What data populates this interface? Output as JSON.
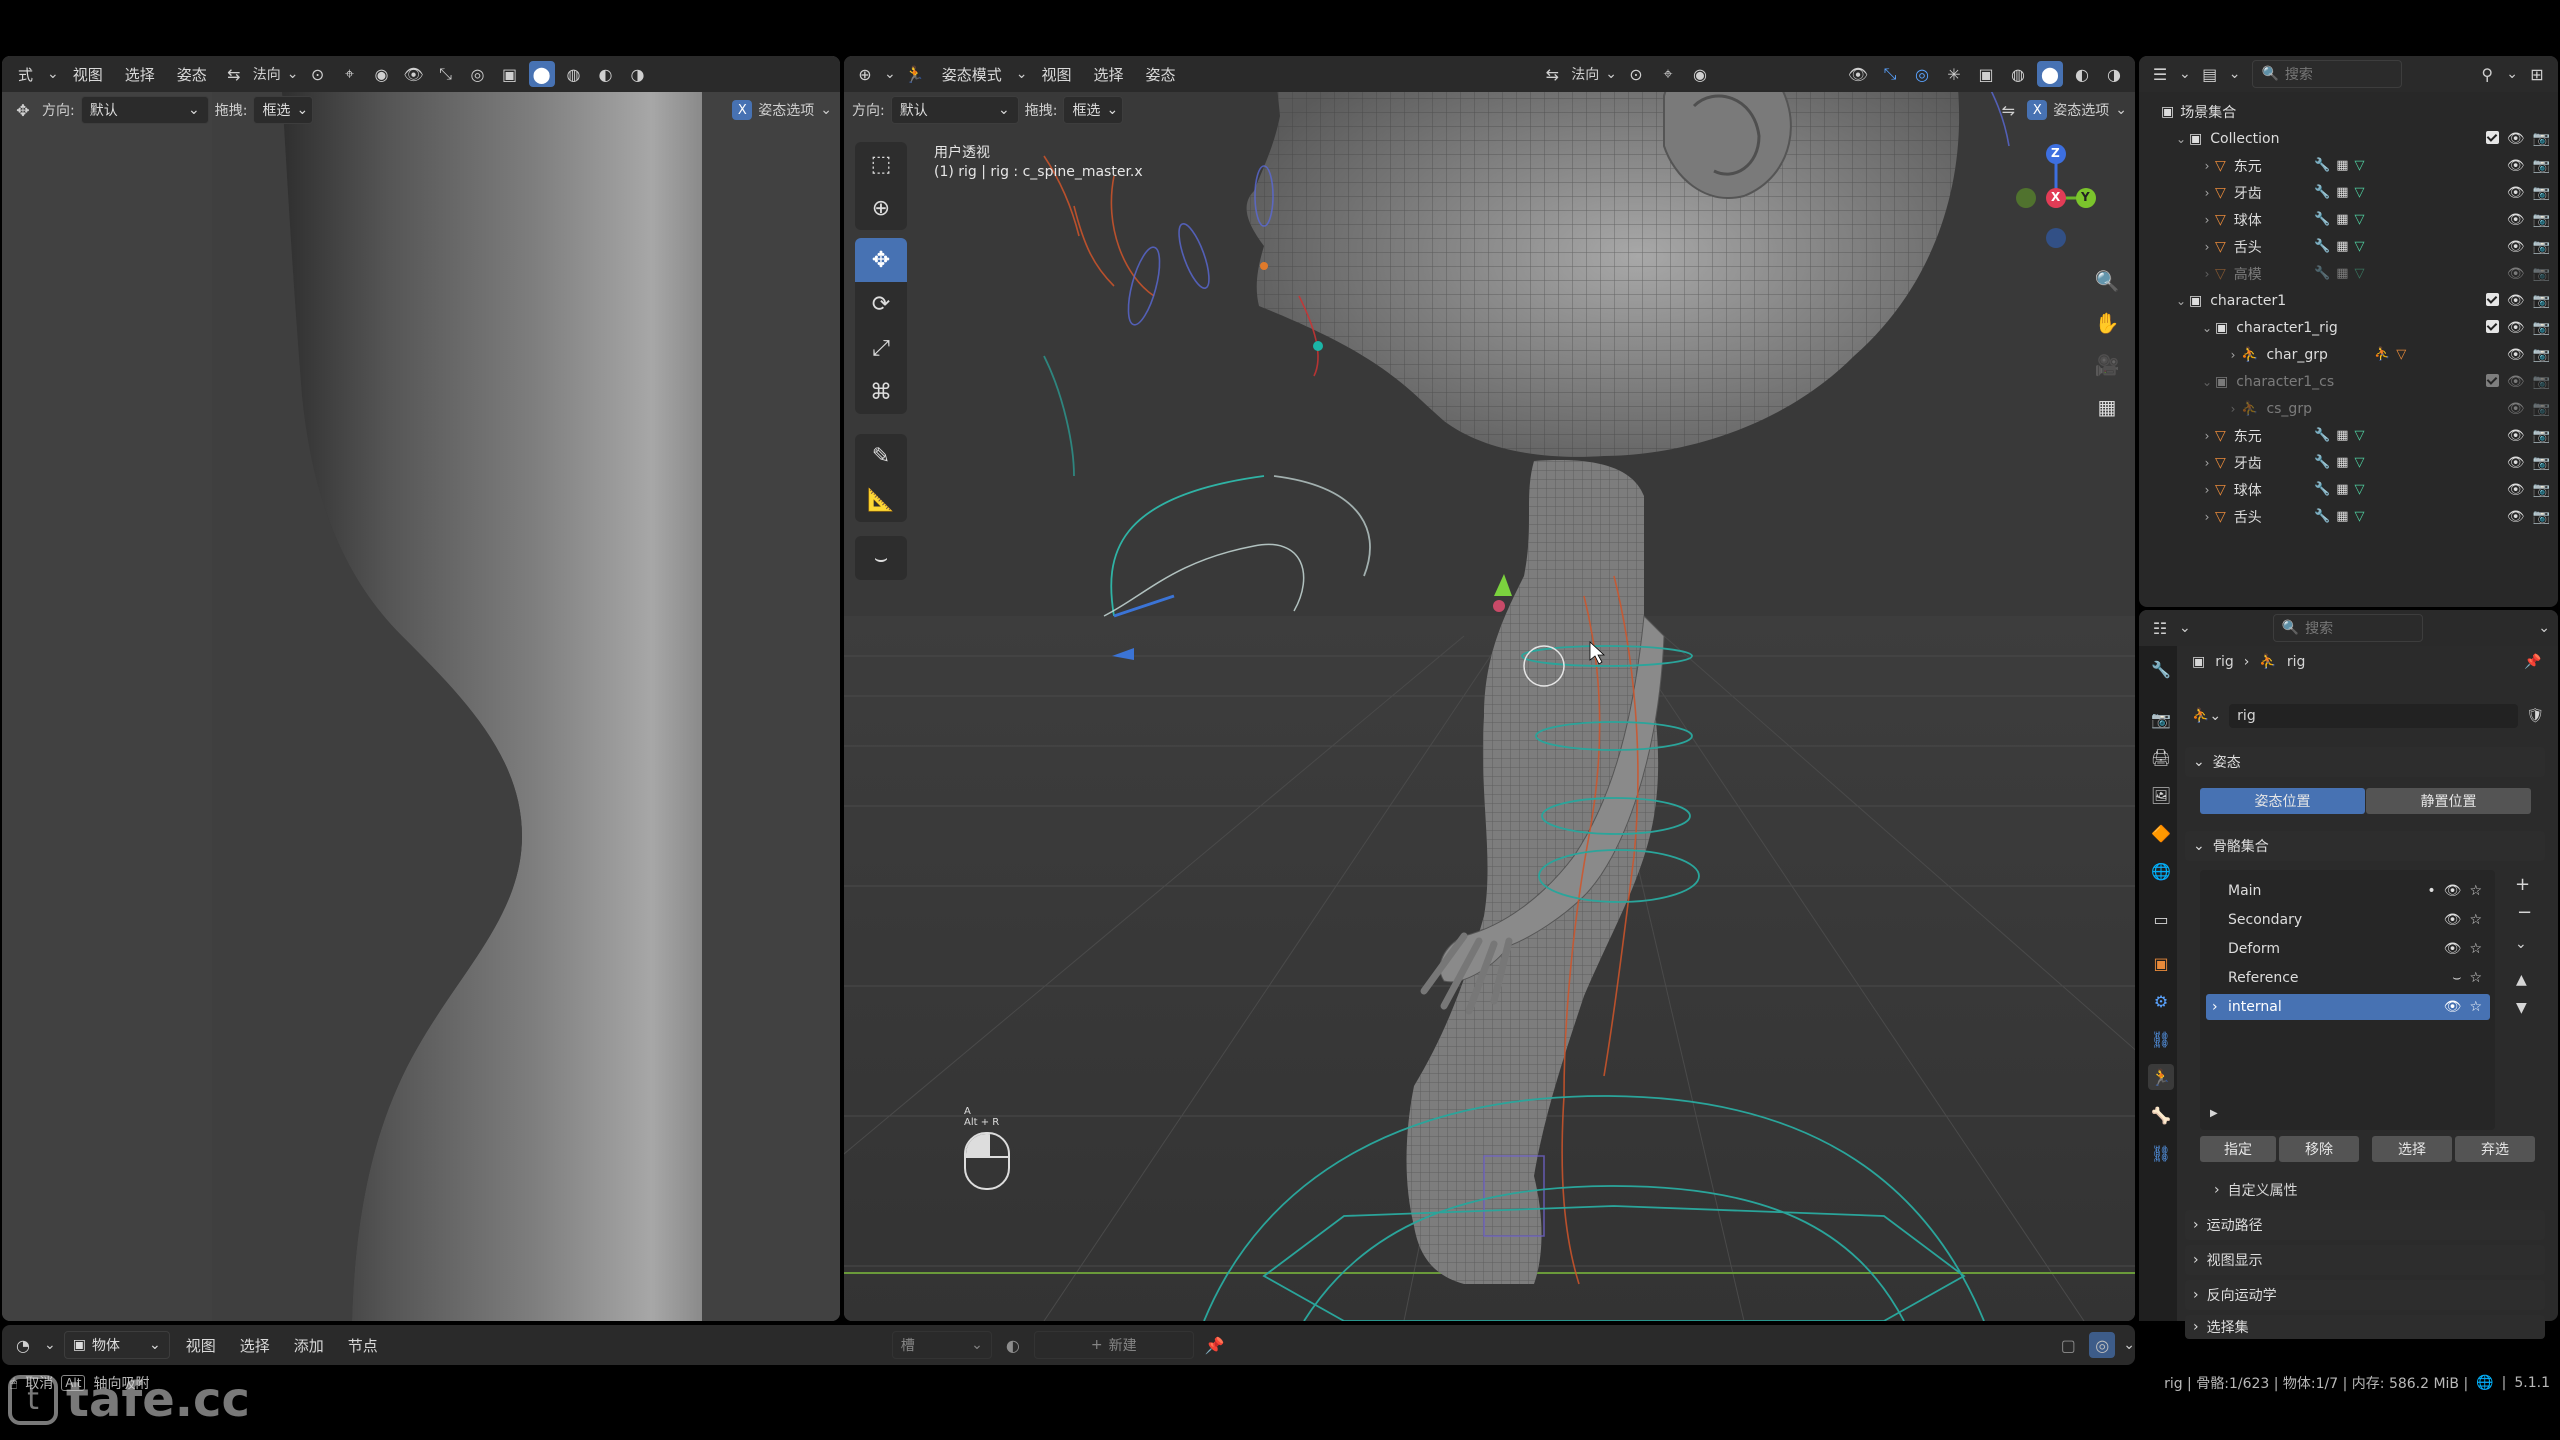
{
  "watermark": "tafe.cc",
  "left_editor": {
    "header": {
      "mode_fragment": "式",
      "menus": [
        "视图",
        "选择",
        "姿态"
      ],
      "orientation": "法向"
    },
    "header2": {
      "orientation_label": "方向:",
      "orientation_value": "默认",
      "drag_label": "拖拽:",
      "drag_value": "框选",
      "pose_options": "姿态选项"
    }
  },
  "viewport": {
    "header": {
      "mode": "姿态模式",
      "menus": [
        "视图",
        "选择",
        "姿态"
      ],
      "orientation": "法向"
    },
    "header2": {
      "orientation_label": "方向:",
      "orientation_value": "默认",
      "drag_label": "拖拽:",
      "drag_value": "框选",
      "pose_options": "姿态选项"
    },
    "overlay": {
      "title": "用户透视",
      "subtitle": "(1) rig | rig : c_spine_master.x"
    },
    "keyhint": {
      "key": "A",
      "combo": "Alt + R"
    },
    "gizmo": {
      "z": "Z",
      "x": "X",
      "y": "Y"
    }
  },
  "outliner": {
    "search_placeholder": "搜索",
    "scene_collection": "场景集合",
    "rows": [
      {
        "name": "Collection",
        "type": "collection",
        "level": 1
      },
      {
        "name": "东元",
        "type": "mesh",
        "level": 2
      },
      {
        "name": "牙齿",
        "type": "mesh",
        "level": 2
      },
      {
        "name": "球体",
        "type": "mesh",
        "level": 2
      },
      {
        "name": "舌头",
        "type": "mesh",
        "level": 2
      },
      {
        "name": "高模",
        "type": "mesh",
        "level": 2,
        "dim": true
      },
      {
        "name": "character1",
        "type": "collection",
        "level": 1
      },
      {
        "name": "character1_rig",
        "type": "collection",
        "level": 2
      },
      {
        "name": "char_grp",
        "type": "armature",
        "level": 3
      },
      {
        "name": "character1_cs",
        "type": "collection",
        "level": 2,
        "dim": true
      },
      {
        "name": "cs_grp",
        "type": "armature",
        "level": 3,
        "dim": true
      },
      {
        "name": "东元",
        "type": "mesh",
        "level": 2
      },
      {
        "name": "牙齿",
        "type": "mesh",
        "level": 2
      },
      {
        "name": "球体",
        "type": "mesh",
        "level": 2
      },
      {
        "name": "舌头",
        "type": "mesh",
        "level": 2
      }
    ]
  },
  "properties": {
    "search_placeholder": "搜索",
    "breadcrumb": [
      "rig",
      "rig"
    ],
    "data_name": "rig",
    "pose_panel": "姿态",
    "pose_position": "姿态位置",
    "rest_position": "静置位置",
    "bone_collections_panel": "骨骼集合",
    "bone_collections": [
      {
        "name": "Main",
        "selected": false
      },
      {
        "name": "Secondary",
        "selected": false
      },
      {
        "name": "Deform",
        "selected": false
      },
      {
        "name": "Reference",
        "selected": false
      },
      {
        "name": "internal",
        "selected": true
      }
    ],
    "buttons": [
      "指定",
      "移除",
      "选择",
      "弃选"
    ],
    "custom_props": "自定义属性",
    "collapsed": [
      "运动路径",
      "视图显示",
      "反向运动学",
      "选择集"
    ]
  },
  "bottom": {
    "mode": "物体",
    "menus": [
      "视图",
      "选择",
      "添加",
      "节点"
    ],
    "slot": "槽",
    "new": "新建"
  },
  "status": {
    "left_key1": "取消",
    "left_key2": "Alt",
    "left_hint": "轴向吸附",
    "text": "rig | 骨骼:1/623 | 物体:1/7 | 内存: 586.2 MiB |",
    "version": "5.1.1"
  }
}
